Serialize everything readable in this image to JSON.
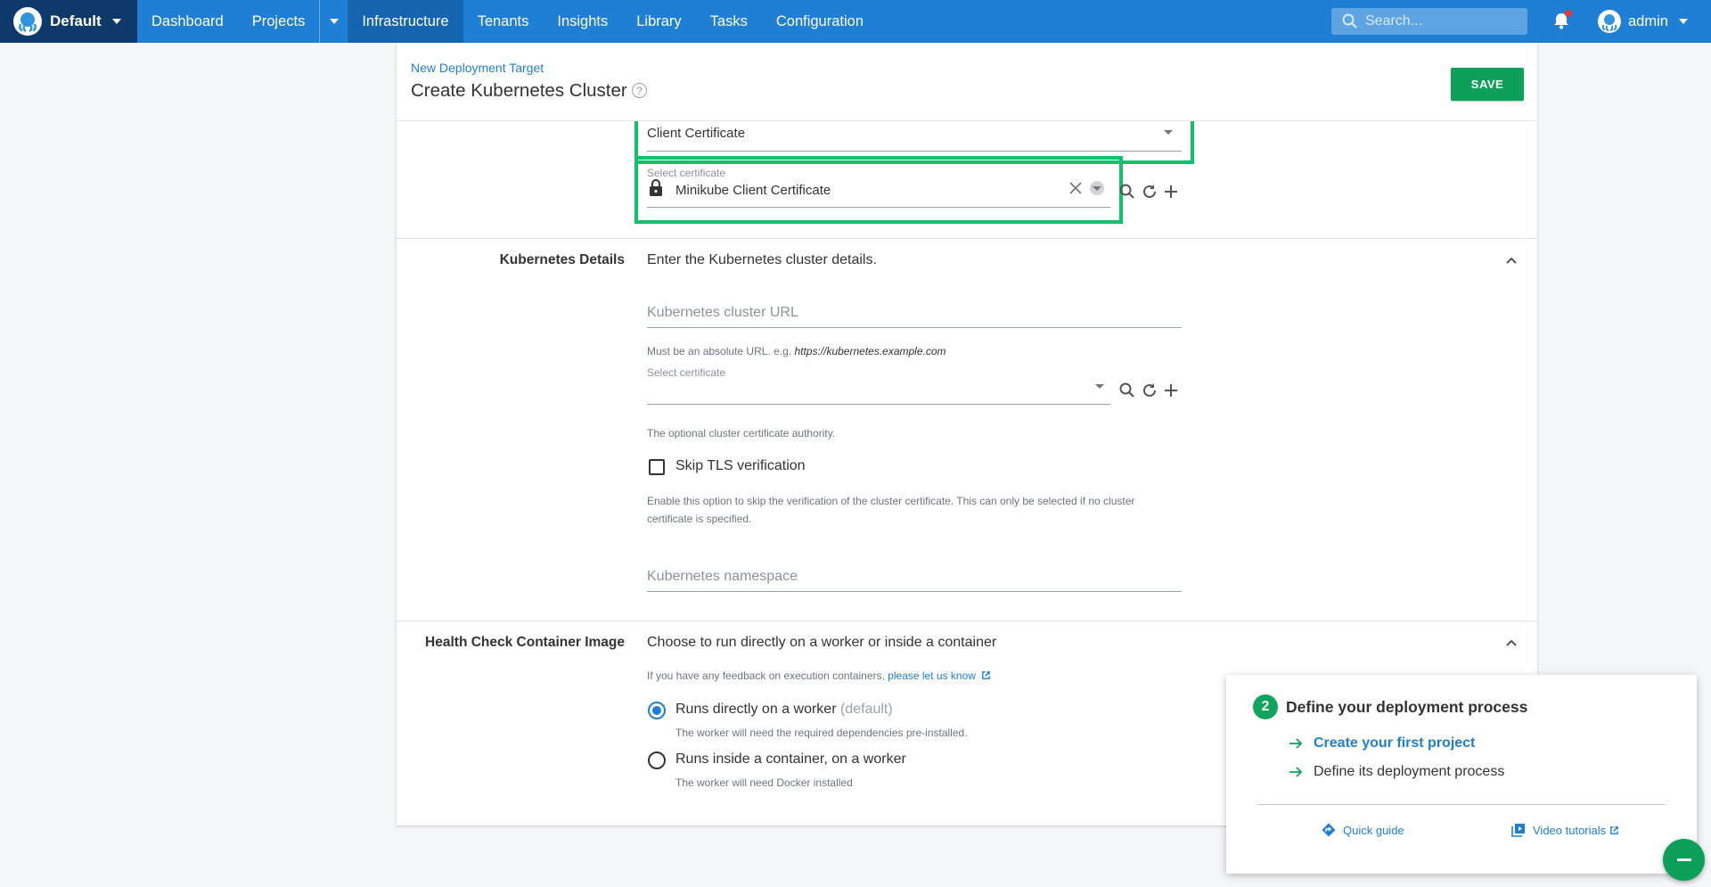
{
  "nav": {
    "space_name": "Default",
    "items": [
      "Dashboard",
      "Projects",
      "Infrastructure",
      "Tenants",
      "Insights",
      "Library",
      "Tasks",
      "Configuration"
    ],
    "active": "Infrastructure",
    "search_placeholder": "Search...",
    "user_name": "admin"
  },
  "header": {
    "breadcrumb": "New Deployment Target",
    "title": "Create Kubernetes Cluster",
    "save_label": "SAVE"
  },
  "auth": {
    "auth_type_value": "Client Certificate",
    "cert_label": "Select certificate",
    "cert_value": "Minikube Client Certificate"
  },
  "kubernetes_details": {
    "title": "Kubernetes Details",
    "description": "Enter the Kubernetes cluster details.",
    "url_placeholder": "Kubernetes cluster URL",
    "url_hint_prefix": "Must be an absolute URL. e.g.",
    "url_hint_example": "https://kubernetes.example.com",
    "cert_label": "Select certificate",
    "cert_hint": "The optional cluster certificate authority.",
    "skip_tls_label": "Skip TLS verification",
    "skip_tls_checked": false,
    "skip_tls_hint_line1": "Enable this option to skip the verification of the cluster certificate. This can only be selected if no cluster",
    "skip_tls_hint_line2": "certificate is specified.",
    "namespace_placeholder": "Kubernetes namespace"
  },
  "health_check": {
    "title": "Health Check Container Image",
    "description": "Choose to run directly on a worker or inside a container",
    "feedback_prefix": "If you have any feedback on execution containers,",
    "feedback_link": "please let us know",
    "option1_label": "Runs directly on a worker",
    "option1_suffix": "(default)",
    "option1_hint": "The worker will need the required dependencies pre-installed.",
    "option2_label": "Runs inside a container, on a worker",
    "option2_hint": "The worker will need Docker installed",
    "selected": "option1"
  },
  "getting_started": {
    "step_number": "2",
    "title": "Define your deployment process",
    "item1": "Create your first project",
    "item2": "Define its deployment process",
    "quick_guide": "Quick guide",
    "video_tutorials": "Video tutorials"
  },
  "colors": {
    "nav_blue": "#1f7fd4",
    "space_dark": "#0d3a6a",
    "accent_green": "#0ca05a",
    "highlight_green": "#10c26a"
  }
}
